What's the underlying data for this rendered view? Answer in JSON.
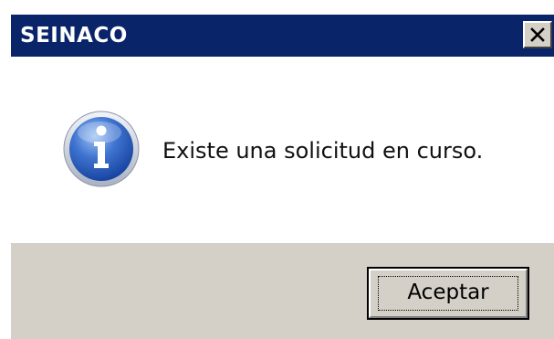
{
  "window": {
    "title": "SEINACO",
    "close_icon": "close-icon"
  },
  "message": {
    "icon": "info-icon",
    "text": "Existe una solicitud en curso."
  },
  "buttons": {
    "accept_label": "Aceptar"
  },
  "colors": {
    "titlebar": "#0a246a",
    "dialog_face": "#d4d0c8",
    "content_bg": "#ffffff",
    "icon_blue": "#2f5fbf"
  }
}
